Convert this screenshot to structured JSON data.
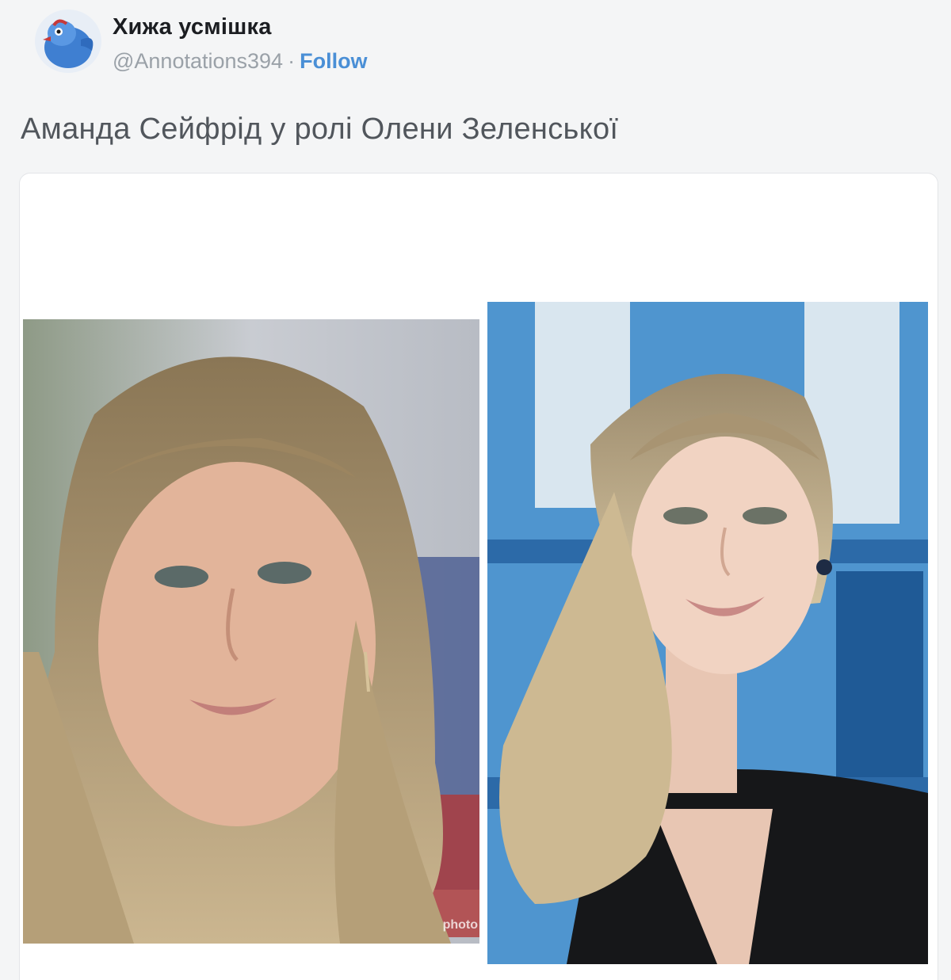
{
  "author": {
    "display_name": "Хижа усмішка",
    "handle": "@Annotations394",
    "separator": "·",
    "follow_label": "Follow",
    "avatar_icon": "blue-bird-avatar-icon"
  },
  "tweet": {
    "text": "Аманда Сейфрід у ролі Олени Зеленської"
  },
  "media": {
    "left_photo": {
      "credit": "photo"
    },
    "right_photo": {}
  },
  "colors": {
    "link": "#4a8fd6",
    "name": "#1b1d21",
    "muted": "#9aa1a8",
    "background": "#f4f5f6"
  }
}
